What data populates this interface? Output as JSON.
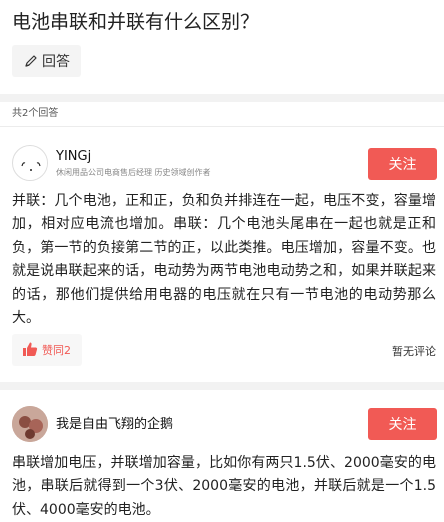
{
  "question": {
    "title": "电池串联和并联有什么区别？",
    "answer_button_label": "回答"
  },
  "answers_count_label": "共2个回答",
  "answers": [
    {
      "author": "YINGj",
      "author_title": "休闲用品公司电商售后经理 历史领域创作者",
      "follow_label": "关注",
      "body": "并联：几个电池，正和正，负和负并排连在一起，电压不变，容量增加，相对应电流也增加。串联：几个电池头尾串在一起也就是正和负，第一节的负接第二节的正，以此类推。电压增加，容量不变。也就是说串联起来的话，电动势为两节电池电动势之和，如果并联起来的话，那他们提供给用电器的电压就在只有一节电池的电动势那么大。",
      "like_label": "赞同2",
      "comment_label": "暂无评论"
    },
    {
      "author": "我是自由飞翔的企鹅",
      "follow_label": "关注",
      "body": "串联增加电压，并联增加容量，比如你有两只1.5伏、2000毫安的电池，串联后就得到一个3伏、2000毫安的电池，并联后就是一个1.5伏、4000毫安的电池。"
    }
  ],
  "colors": {
    "accent": "#f15a55",
    "divider": "#f2f2f2"
  }
}
